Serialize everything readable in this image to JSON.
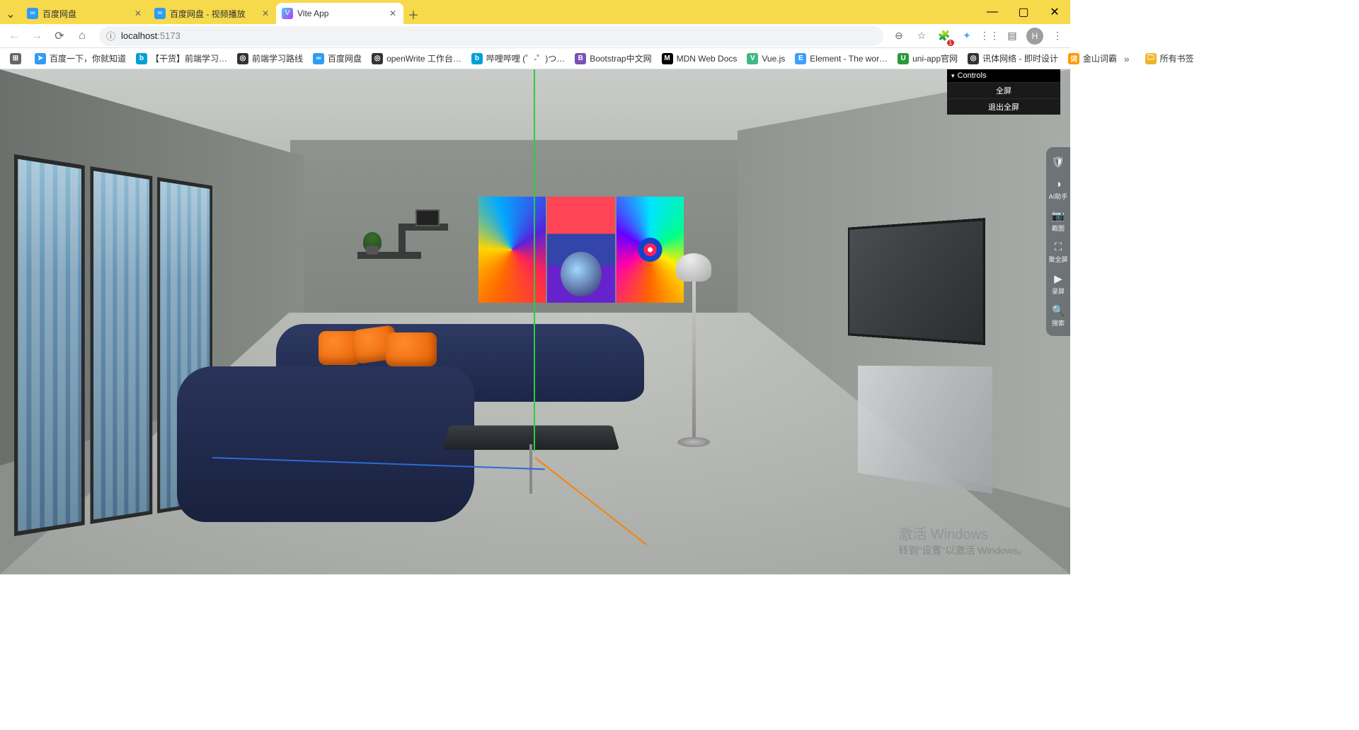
{
  "tabs": [
    {
      "title": "百度网盘",
      "favicon_bg": "#2f9cf4",
      "favicon_text": "∞"
    },
    {
      "title": "百度网盘 - 视频播放",
      "favicon_bg": "#2f9cf4",
      "favicon_text": "∞"
    },
    {
      "title": "Vite App",
      "favicon_bg": "linear-gradient(135deg,#41d1ff,#bd34fe)",
      "favicon_text": "V",
      "active": true
    }
  ],
  "address": {
    "host": "localhost",
    "path": ":5173"
  },
  "toolbar_icons": {
    "zoom": "⊖",
    "star": "☆",
    "ext_badge": "1",
    "folder_label": "所有书签"
  },
  "avatar_initial": "H",
  "bookmarks": [
    {
      "label": "",
      "icon_bg": "#666",
      "icon_text": "⊞"
    },
    {
      "label": "百度一下，你就知道",
      "icon_bg": "#2f9cf4",
      "icon_text": "➤"
    },
    {
      "label": "【干货】前端学习…",
      "icon_bg": "#00a1d6",
      "icon_text": "b"
    },
    {
      "label": "前端学习路线",
      "icon_bg": "#333",
      "icon_text": "◎"
    },
    {
      "label": "百度网盘",
      "icon_bg": "#2f9cf4",
      "icon_text": "∞"
    },
    {
      "label": "openWrite 工作台…",
      "icon_bg": "#333",
      "icon_text": "◎"
    },
    {
      "label": "哔哩哔哩 (゜-゜)つ…",
      "icon_bg": "#00a1d6",
      "icon_text": "b"
    },
    {
      "label": "Bootstrap中文网",
      "icon_bg": "#7952b3",
      "icon_text": "B"
    },
    {
      "label": "MDN Web Docs",
      "icon_bg": "#000",
      "icon_text": "M"
    },
    {
      "label": "Vue.js",
      "icon_bg": "#41b883",
      "icon_text": "V"
    },
    {
      "label": "Element - The wor…",
      "icon_bg": "#409eff",
      "icon_text": "E"
    },
    {
      "label": "uni-app官网",
      "icon_bg": "#2b9939",
      "icon_text": "U"
    },
    {
      "label": "讯体网络 - 即时设计",
      "icon_bg": "#333",
      "icon_text": "◎"
    },
    {
      "label": "金山词霸",
      "icon_bg": "#ff9900",
      "icon_text": "词"
    }
  ],
  "datgui": {
    "title": "Controls",
    "rows": [
      "全屏",
      "退出全屏"
    ]
  },
  "sidebar": [
    {
      "icon": "🛡",
      "label": ""
    },
    {
      "icon": "◑",
      "label": "AI助手"
    },
    {
      "icon": "📷",
      "label": "截图"
    },
    {
      "icon": "⛶",
      "label": "聚全屏"
    },
    {
      "icon": "▶",
      "label": "录屏"
    },
    {
      "icon": "🔍",
      "label": "搜索"
    }
  ],
  "watermark": {
    "line1": "激活 Windows",
    "line2": "转到\"设置\"以激活 Windows。"
  }
}
